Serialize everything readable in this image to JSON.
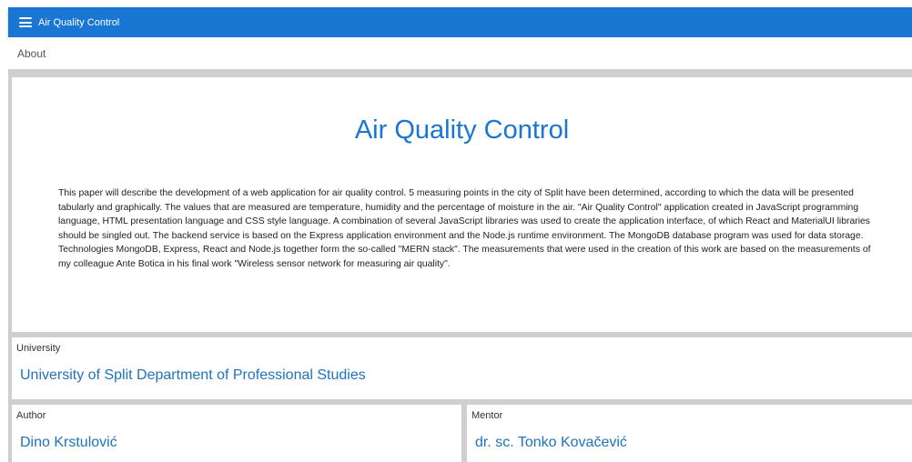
{
  "appbar": {
    "menu_icon": "menu-icon",
    "title": "Air Quality Control"
  },
  "tabs": [
    {
      "label": "About"
    }
  ],
  "main": {
    "title": "Air Quality Control",
    "abstract": "This paper will describe the development of a web application for air quality control. 5 measuring points in the city of Split have been determined, according to which the data will be presented tabularly and graphically. The values that are measured are temperature, humidity and the percentage of moisture in the air. \"Air Quality Control\" application created in JavaScript programming language, HTML presentation language and CSS style language. A combination of several JavaScript libraries was used to create the application interface, of which React and MaterialUI libraries should be singled out. The backend service is based on the Express application environment and the Node.js runtime environment. The MongoDB database program was used for data storage. Technologies MongoDB, Express, React and Node.js together form the so-called \"MERN stack\". The measurements that were used in the creation of this work are based on the measurements of my colleague Ante Botica in his final work \"Wireless sensor network for measuring air quality\"."
  },
  "university": {
    "label": "University",
    "value": "University of Split Department of Professional Studies"
  },
  "author": {
    "label": "Author",
    "value": "Dino Krstulović"
  },
  "mentor": {
    "label": "Mentor",
    "value": "dr. sc. Tonko Kovačević"
  },
  "colors": {
    "appbar": "#1976d2",
    "accent_text": "#1e73be",
    "background": "#cfcfcf"
  }
}
